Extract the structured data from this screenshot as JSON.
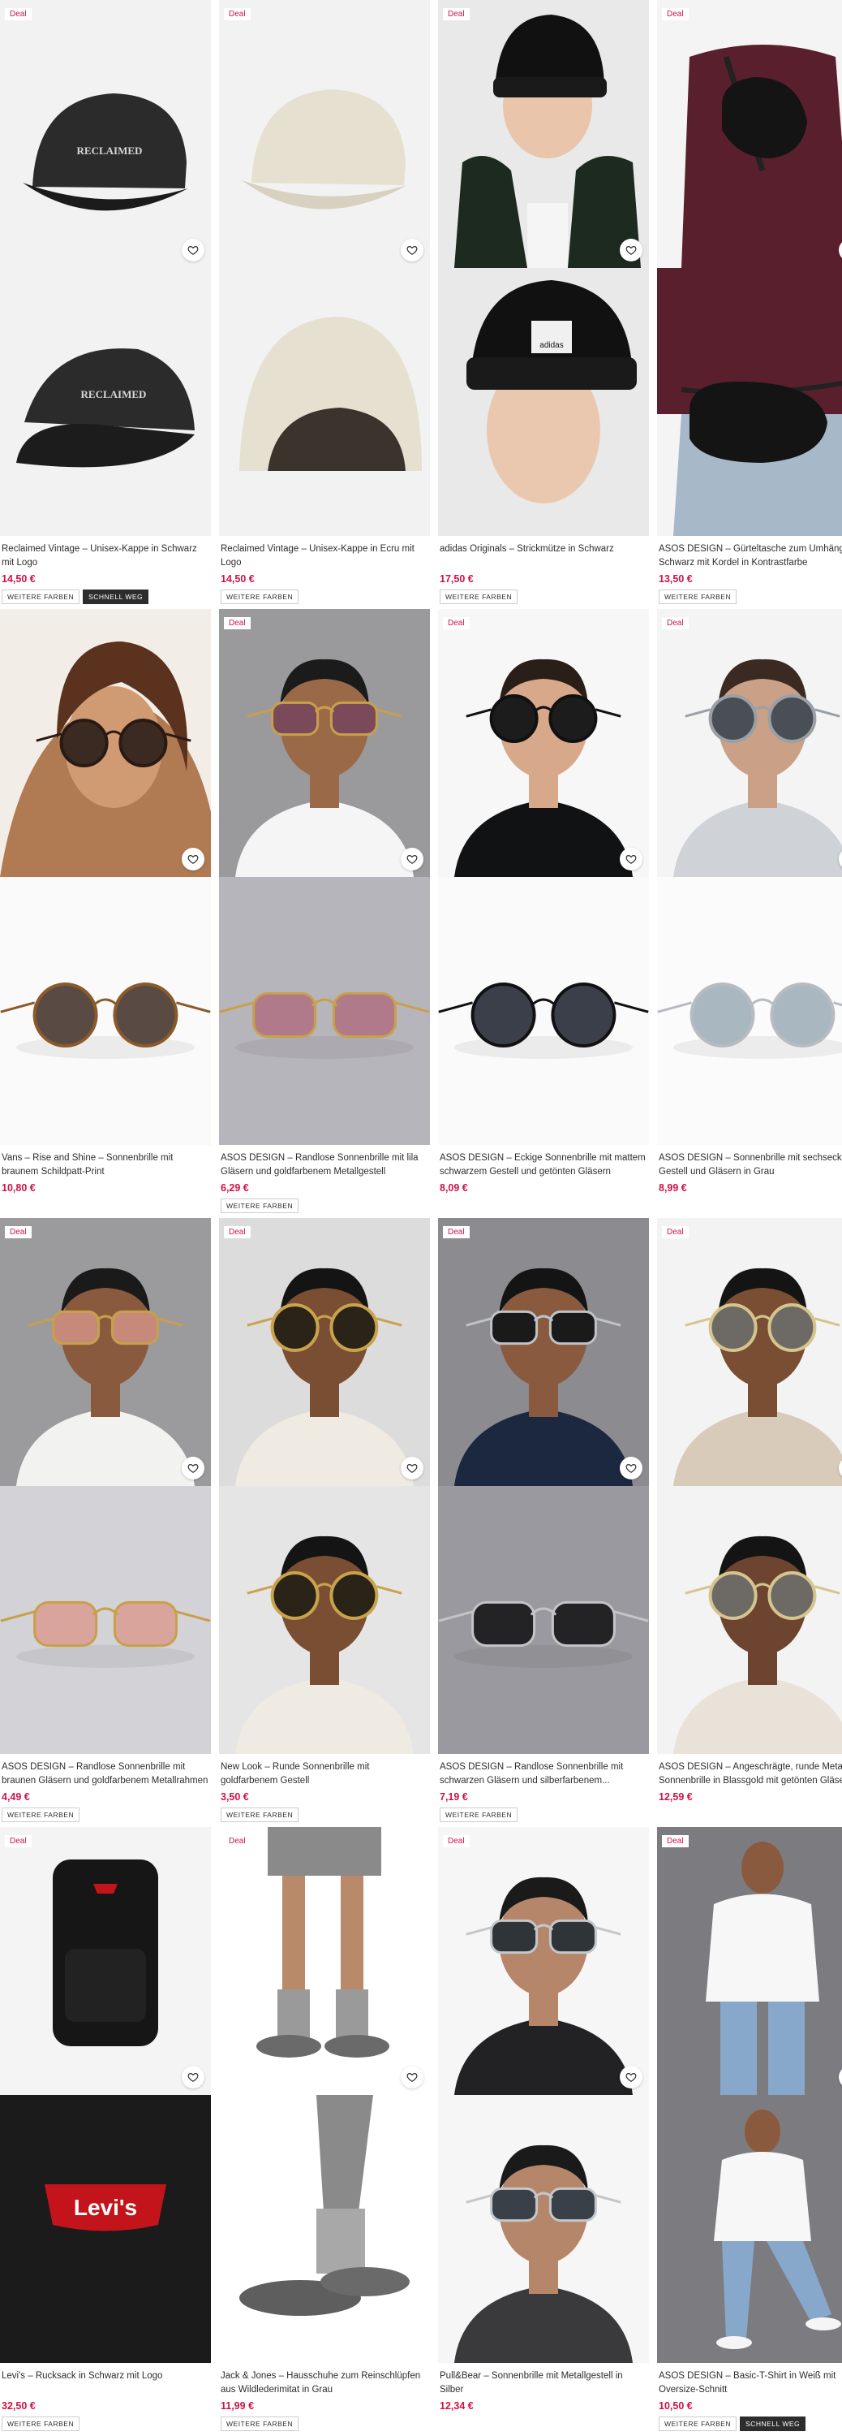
{
  "colors": {
    "deal": "#d01345",
    "price": "#d01345",
    "tag_dark": "#2d2d2d"
  },
  "badge_label": "Deal",
  "products": [
    {
      "deal": true,
      "title": "Reclaimed Vintage – Unisex-Kappe in Schwarz mit Logo",
      "price": "14,50 €",
      "tags": [
        "WEITERE FARBEN",
        "SCHNELL WEG"
      ],
      "icon": "black-cap"
    },
    {
      "deal": true,
      "title": "Reclaimed Vintage – Unisex-Kappe in Ecru mit Logo",
      "price": "14,50 €",
      "tags": [
        "WEITERE FARBEN"
      ],
      "icon": "ecru-cap"
    },
    {
      "deal": true,
      "title": "adidas Originals – Strickmütze in Schwarz",
      "price": "17,50 €",
      "tags": [
        "WEITERE FARBEN"
      ],
      "icon": "beanie"
    },
    {
      "deal": true,
      "title": "ASOS DESIGN – Gürteltasche zum Umhängen in Schwarz mit Kordel in Kontrastfarbe",
      "price": "13,50 €",
      "tags": [
        "WEITERE FARBEN"
      ],
      "icon": "belt-bag"
    },
    {
      "deal": false,
      "title": "Vans – Rise and Shine – Sonnenbrille mit braunem Schildpatt-Print",
      "price": "10,80 €",
      "tags": [],
      "icon": "sunglasses-tortoise"
    },
    {
      "deal": true,
      "title": "ASOS DESIGN – Randlose Sonnenbrille mit lila Gläsern und goldfarbenem Metallgestell",
      "price": "6,29 €",
      "tags": [
        "WEITERE FARBEN"
      ],
      "icon": "sunglasses-rimless-lilac"
    },
    {
      "deal": true,
      "title": "ASOS DESIGN – Eckige Sonnenbrille mit mattem schwarzem Gestell und getönten Gläsern",
      "price": "8,09 €",
      "tags": [],
      "icon": "sunglasses-black"
    },
    {
      "deal": true,
      "title": "ASOS DESIGN – Sonnenbrille mit sechseckigem Gestell und Gläsern in Grau",
      "price": "8,99 €",
      "tags": [],
      "icon": "sunglasses-grey"
    },
    {
      "deal": true,
      "title": "ASOS DESIGN – Randlose Sonnenbrille mit braunen Gläsern und goldfarbenem Metallrahmen",
      "price": "4,49 €",
      "tags": [
        "WEITERE FARBEN"
      ],
      "icon": "sunglasses-rimless-brown"
    },
    {
      "deal": true,
      "title": "New Look – Runde Sonnenbrille mit goldfarbenem Gestell",
      "price": "3,50 €",
      "tags": [
        "WEITERE FARBEN"
      ],
      "icon": "sunglasses-round-gold"
    },
    {
      "deal": true,
      "title": "ASOS DESIGN – Randlose Sonnenbrille mit schwarzen Gläsern und silberfarbenem...",
      "price": "7,19 €",
      "tags": [
        "WEITERE FARBEN"
      ],
      "icon": "sunglasses-rimless-black"
    },
    {
      "deal": true,
      "title": "ASOS DESIGN – Angeschrägte, runde Metall-Sonnenbrille in Blassgold mit getönten Gläsern",
      "price": "12,59 €",
      "tags": [],
      "icon": "sunglasses-round-pale"
    },
    {
      "deal": true,
      "title": "Levi's – Rucksack in Schwarz mit Logo",
      "price": "32,50 €",
      "tags": [
        "WEITERE FARBEN"
      ],
      "icon": "backpack"
    },
    {
      "deal": true,
      "title": "Jack & Jones – Hausschuhe zum Reinschlüpfen aus Wildlederimitat in Grau",
      "price": "11,99 €",
      "tags": [
        "WEITERE FARBEN"
      ],
      "icon": "slippers"
    },
    {
      "deal": true,
      "title": "Pull&Bear – Sonnenbrille mit Metallgestell in Silber",
      "price": "12,34 €",
      "tags": [],
      "icon": "sunglasses-silver"
    },
    {
      "deal": true,
      "title": "ASOS DESIGN – Basic-T-Shirt in Weiß mit Oversize-Schnitt",
      "price": "10,50 €",
      "tags": [
        "WEITERE FARBEN",
        "SCHNELL WEG"
      ],
      "icon": "white-tshirt"
    }
  ]
}
